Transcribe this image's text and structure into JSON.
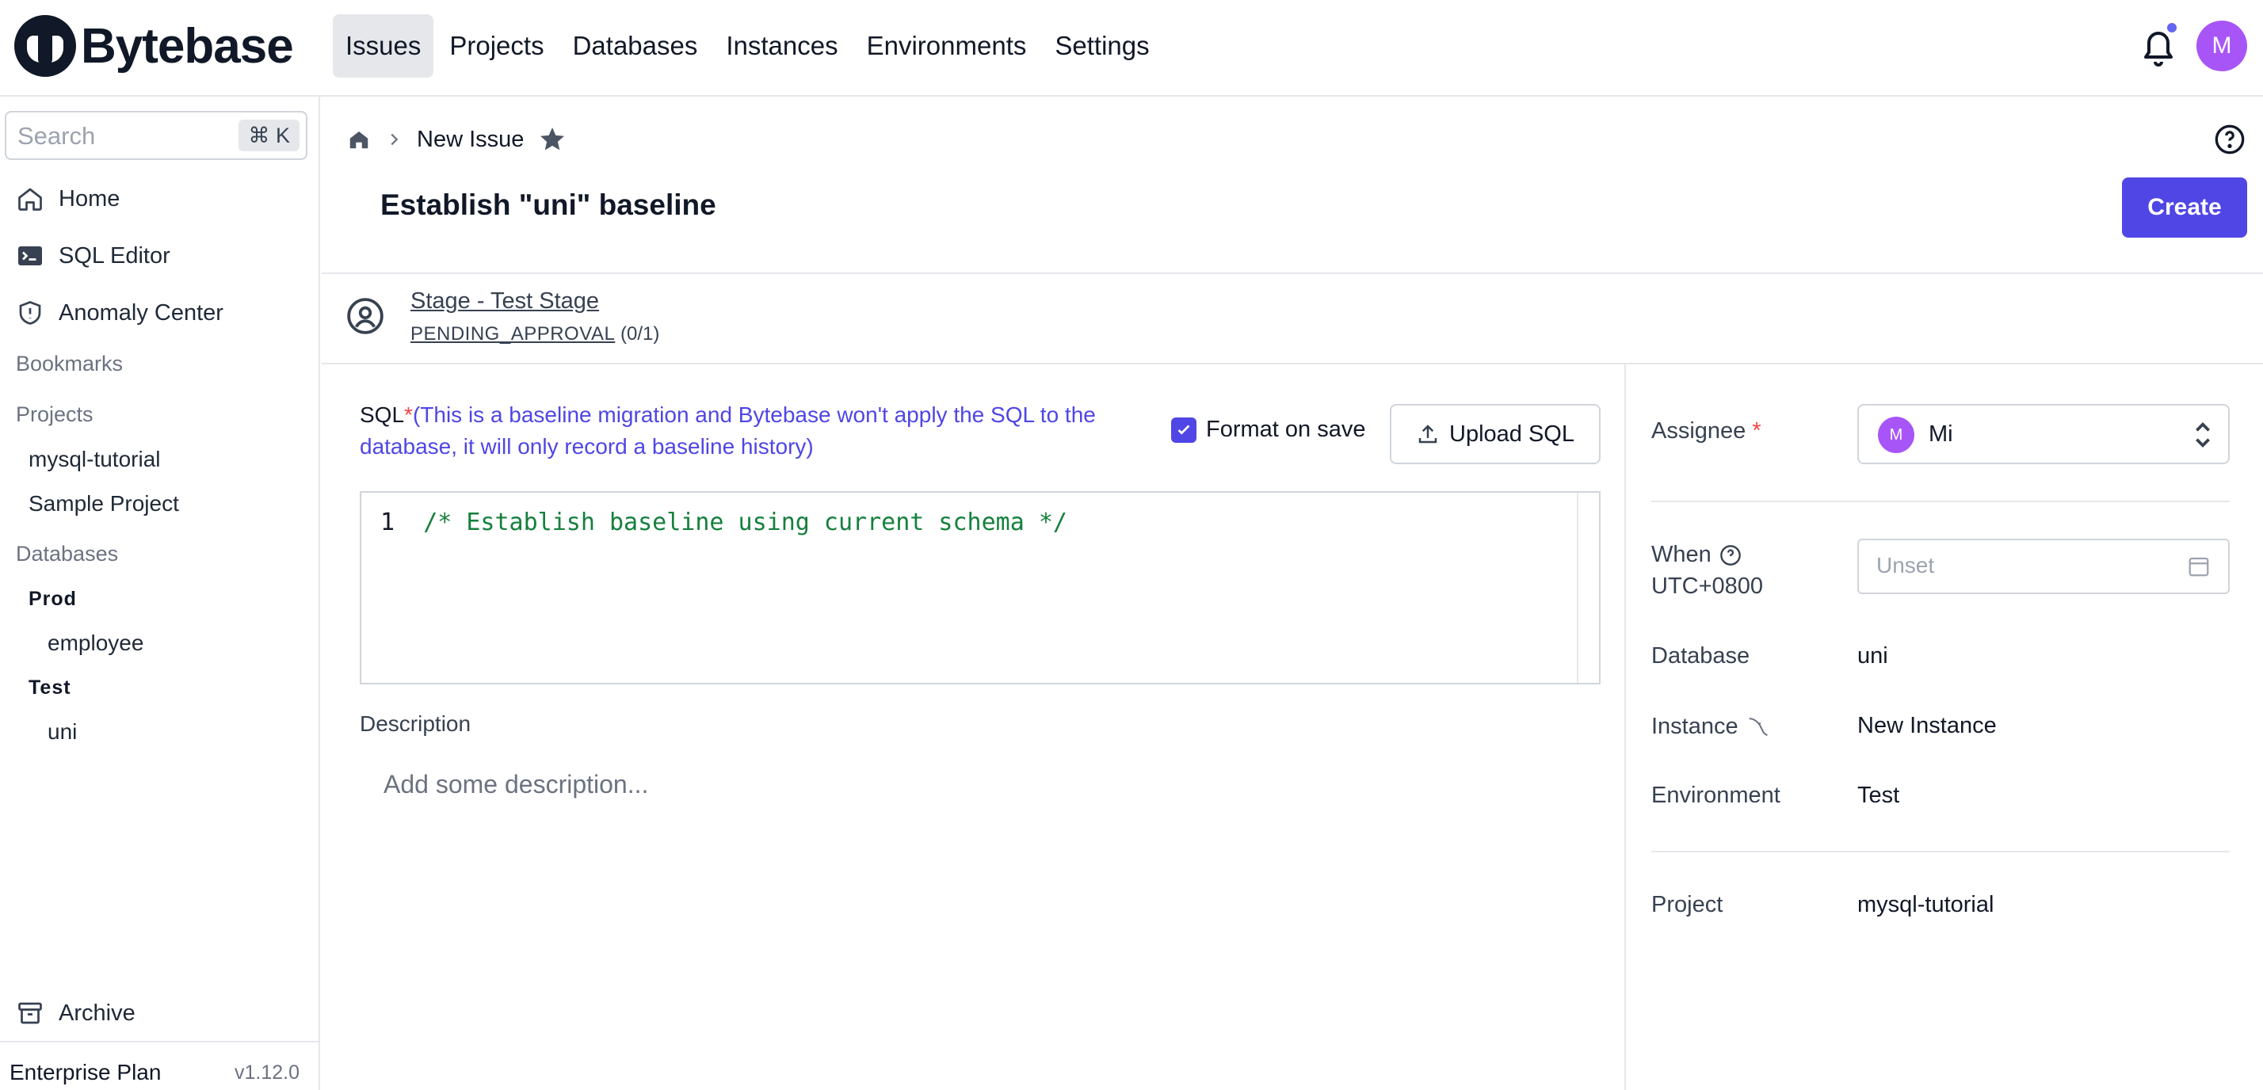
{
  "app": {
    "name": "Bytebase"
  },
  "nav": {
    "items": [
      "Issues",
      "Projects",
      "Databases",
      "Instances",
      "Environments",
      "Settings"
    ],
    "active_index": 0
  },
  "user": {
    "initial": "M"
  },
  "sidebar": {
    "search_placeholder": "Search",
    "search_shortcut": "⌘ K",
    "links": {
      "home": "Home",
      "sql_editor": "SQL Editor",
      "anomaly_center": "Anomaly Center"
    },
    "bookmarks_label": "Bookmarks",
    "projects_label": "Projects",
    "projects": [
      "mysql-tutorial",
      "Sample Project"
    ],
    "databases_label": "Databases",
    "environments": [
      {
        "name": "Prod",
        "databases": [
          "employee"
        ]
      },
      {
        "name": "Test",
        "databases": [
          "uni"
        ]
      }
    ],
    "archive": "Archive",
    "plan": "Enterprise Plan",
    "version": "v1.12.0"
  },
  "breadcrumb": {
    "current": "New Issue"
  },
  "issue": {
    "title": "Establish \"uni\" baseline",
    "create_label": "Create"
  },
  "stage": {
    "name": "Stage - Test Stage",
    "status": "PENDING_APPROVAL",
    "progress": "(0/1)"
  },
  "sql": {
    "label": "SQL",
    "required_mark": "*",
    "note": "(This is a baseline migration and Bytebase won't apply the SQL to the database, it will only record a baseline history)",
    "format_on_save_label": "Format on save",
    "format_on_save_checked": true,
    "upload_label": "Upload SQL",
    "line_number": "1",
    "code": "/* Establish baseline using current schema */"
  },
  "description": {
    "label": "Description",
    "placeholder": "Add some description..."
  },
  "details": {
    "assignee_label": "Assignee",
    "assignee_required": "*",
    "assignee_initial": "M",
    "assignee_name": "Mi",
    "when_label": "When",
    "timezone": "UTC+0800",
    "when_placeholder": "Unset",
    "database_label": "Database",
    "database_value": "uni",
    "instance_label": "Instance",
    "instance_value": "New Instance",
    "environment_label": "Environment",
    "environment_value": "Test",
    "project_label": "Project",
    "project_value": "mysql-tutorial"
  },
  "colors": {
    "accent": "#4f46e5",
    "required": "#ef4444",
    "avatar": "#a855f7",
    "code": "#15803d"
  }
}
